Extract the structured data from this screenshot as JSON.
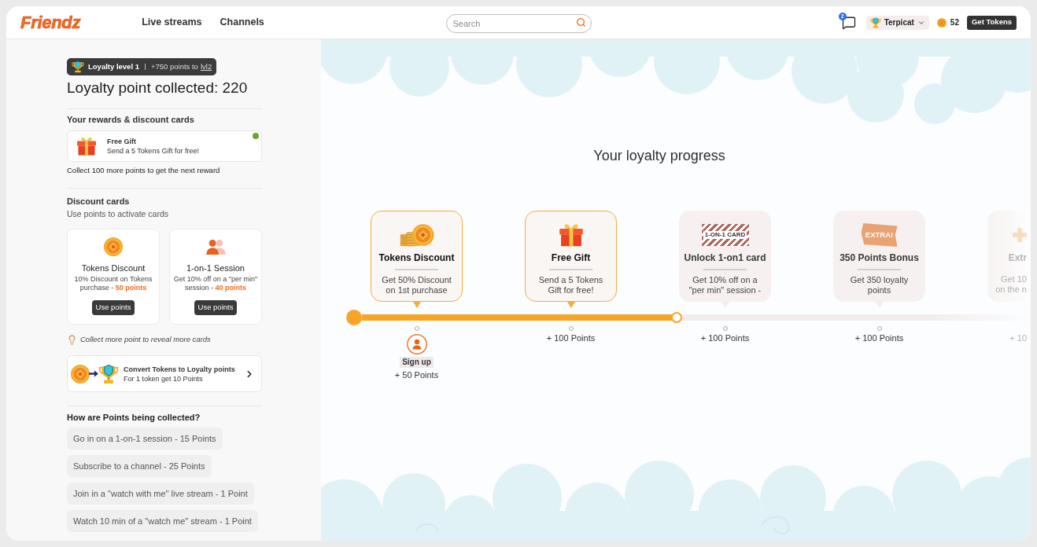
{
  "header": {
    "logo": "Friendz",
    "nav": [
      {
        "label": "Live streams"
      },
      {
        "label": "Channels"
      }
    ],
    "search": {
      "placeholder": "Search"
    },
    "messages_badge": "2",
    "user": {
      "name": "Terpicat"
    },
    "tokens": "52",
    "get_tokens_button": "Get Tokens"
  },
  "loyalty": {
    "level": "Loyalty level 1",
    "progress_text": "+750 points to",
    "progress_link": "lvl2",
    "collected": "Loyalty point collected: 220"
  },
  "rewards": {
    "heading": "Your rewards & discount cards",
    "items": [
      {
        "title": "Free Gift",
        "description": "Send a 5 Tokens Gift for free!",
        "active": true
      }
    ],
    "note": "Collect 100 more points to get the next reward"
  },
  "discount_cards": {
    "heading": "Discount cards",
    "subheading": "Use points to activate cards",
    "items": [
      {
        "title": "Tokens Discount",
        "description": "10% Discount on Tokens purchase -",
        "cost": "50 points",
        "button": "Use points"
      },
      {
        "title": "1-on-1 Session",
        "description": "Get 10% off on a \"per min\" session -",
        "cost": "40 points",
        "button": "Use points"
      }
    ],
    "hint": "Collect more point to reveal more cards"
  },
  "convert": {
    "title": "Convert Tokens to Loyalty points",
    "subtitle": "For 1 token get 10 Points"
  },
  "points_rules": {
    "heading": "How are Points being collected?",
    "items": [
      "Go in on a 1-on-1 session - 15 Points",
      "Subscribe to a channel - 25 Points",
      "Join in a \"watch with me\" live stream - 1 Point",
      "Watch 10 min of a \"watch me\" stream - 1 Point"
    ]
  },
  "progress": {
    "title": "Your loyalty progress",
    "level": 0.47,
    "milestones": [
      {
        "kind": "full",
        "title": "Tokens Discount",
        "description": "Get 50% Discount on 1st purchase",
        "reached": true,
        "step_label": "Sign up",
        "points": "+ 50 Points"
      },
      {
        "kind": "full",
        "title": "Free Gift",
        "description": "Send a 5 Tokens Gift for free!",
        "reached": true,
        "points": "+ 100 Points"
      },
      {
        "kind": "full",
        "image_text": "1-ON-1 CARD",
        "title": "Unlock 1-on1 card",
        "description": "Get 10% off on a \"per min\" session -",
        "reached": false,
        "points": "+ 100 Points"
      },
      {
        "kind": "full",
        "image_text": "EXTRA!",
        "title": "350 Points Bonus",
        "description": "Get 350 loyalty points",
        "reached": false,
        "points": "+ 100 Points"
      },
      {
        "kind": "partial",
        "title": "Extr",
        "description": "Get 10\non the n",
        "reached": false,
        "points": "+ 10"
      }
    ]
  }
}
